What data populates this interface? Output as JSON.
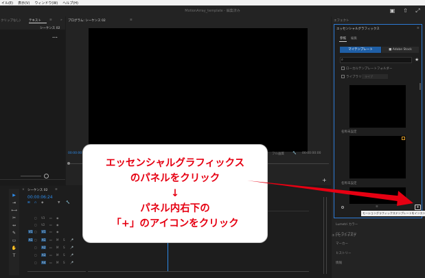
{
  "menu": {
    "items": [
      "イル(E)",
      "表示(V)",
      "ウィンドウ(W)",
      "ヘルプ(H)"
    ]
  },
  "window": {
    "title": "MotionArray_template - 編集済み"
  },
  "project_panel": {
    "tab1": "クリップなし)",
    "tab2": "テキスト",
    "sequence": "シーケンス 02",
    "more": "•••"
  },
  "program": {
    "tab": "プログラム: シーケンス 02",
    "timecode_left": "00:00:00",
    "fit": "フル画質",
    "timecode_right": "00:00:00:00"
  },
  "effects": {
    "panel_tab": "エフェクト",
    "title": "エッセンシャルグラフィックス",
    "tab_browse": "参照",
    "tab_edit": "編集",
    "my_templates": "マイテンプレート",
    "adobe_stock": "Adobe Stock",
    "local_folder": "ローカルテンプレートフォルダー",
    "library": "ライブラリ",
    "library_select": "ライブ",
    "unnamed1": "名称未設定",
    "unnamed2": "名称未設定"
  },
  "timeline": {
    "sequence": "シーケンス 02",
    "timecode": "00:00:06:24",
    "tracks": [
      "V3",
      "V2",
      "V1",
      "A1",
      "A2",
      "A3",
      "A4"
    ]
  },
  "right_list": [
    "エッセンシャルグ",
    "Lumetri カラー",
    "CC ライブラリ",
    "マーカー",
    "ヒストリー",
    "情報"
  ],
  "tooltip": "モーショングラフィックステンプレートをインストール",
  "callout": {
    "line1": "エッセンシャルグラフィックス",
    "line2": "のパネルをクリック",
    "arrow": "↓",
    "line3": "パネル内右下の",
    "line4": "「+」のアイコンをクリック"
  },
  "colors": {
    "accent": "#2d8ceb",
    "callout_text": "#e60012",
    "arrow": "#e60012"
  }
}
